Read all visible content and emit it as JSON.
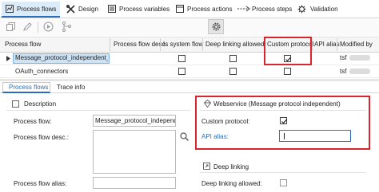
{
  "tabs": [
    {
      "label": "Process flows",
      "icon": "process-flows-icon",
      "active": true
    },
    {
      "label": "Design",
      "icon": "design-tools-icon",
      "active": false
    },
    {
      "label": "Process variables",
      "icon": "variables-icon",
      "active": false
    },
    {
      "label": "Process actions",
      "icon": "actions-icon",
      "active": false
    },
    {
      "label": "Process steps",
      "icon": "steps-icon",
      "active": false
    },
    {
      "label": "Validation",
      "icon": "validation-icon",
      "active": false
    }
  ],
  "table": {
    "columns": [
      "Process flow",
      "Process flow desc.",
      "Is system flow",
      "Deep linking allowed",
      "Custom protocol",
      "API alias",
      "Modified by"
    ],
    "rows": [
      {
        "name": "Message_protocol_independent_w",
        "selected": true,
        "is_system": false,
        "deep_linking": false,
        "custom_protocol": true,
        "modified_by": "tsf"
      },
      {
        "name": "OAuth_connectors",
        "selected": false,
        "is_system": false,
        "deep_linking": false,
        "custom_protocol": false,
        "modified_by": "tsf"
      }
    ]
  },
  "detail_tabs": [
    "Process flows",
    "Trace info"
  ],
  "description": {
    "header": "Description",
    "process_flow_label": "Process flow:",
    "process_flow_value": "Message_protocol_independent",
    "desc_label": "Process flow desc.:",
    "alias_label": "Process flow alias:"
  },
  "webservice": {
    "header": "Webservice (Message protocol independent)",
    "custom_protocol_label": "Custom protocol:",
    "custom_protocol_checked": true,
    "api_alias_label": "API alias:",
    "api_alias_value": ""
  },
  "deep_linking": {
    "header": "Deep linking",
    "allowed_label": "Deep linking allowed:",
    "allowed_checked": false
  },
  "colors": {
    "highlight": "#d9262e",
    "accent": "#2a6ebb",
    "selection": "#cde3f6"
  }
}
